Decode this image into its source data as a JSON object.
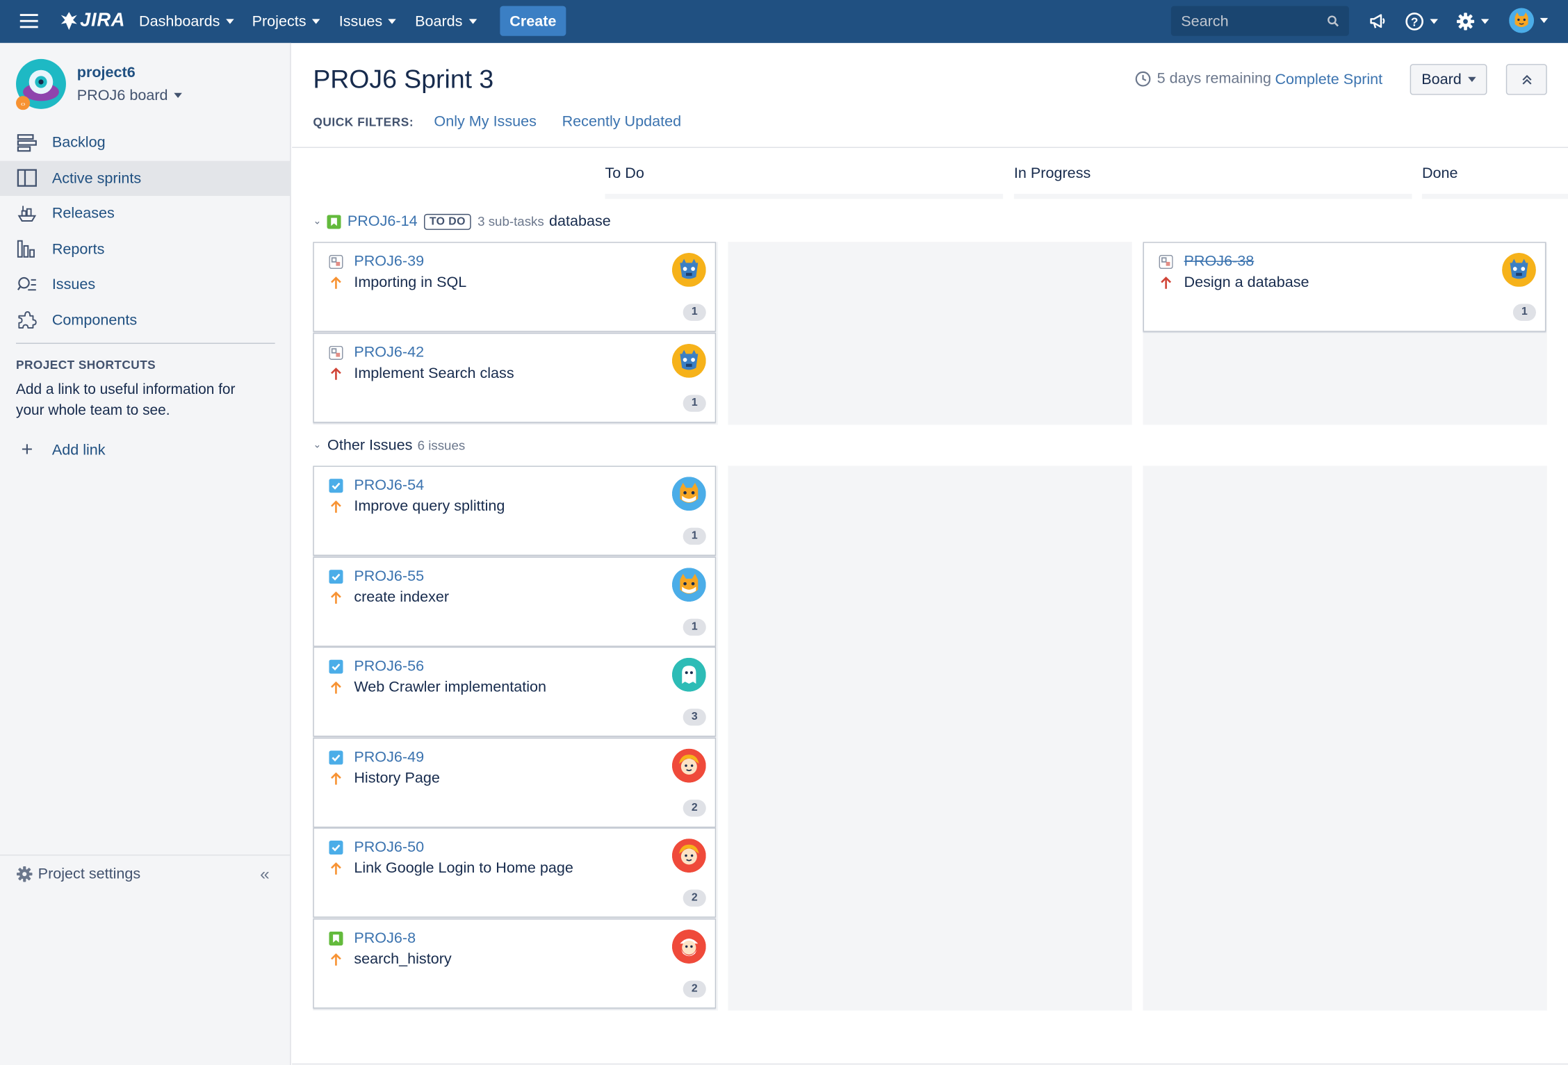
{
  "nav": {
    "logo": "JIRA",
    "dashboards": "Dashboards",
    "projects": "Projects",
    "issues": "Issues",
    "boards": "Boards",
    "create": "Create",
    "search_placeholder": "Search"
  },
  "sidebar": {
    "project_name": "project6",
    "board_name": "PROJ6 board",
    "items": [
      {
        "label": "Backlog",
        "icon": "backlog-icon"
      },
      {
        "label": "Active sprints",
        "icon": "active-sprints-icon",
        "active": true
      },
      {
        "label": "Releases",
        "icon": "releases-icon"
      },
      {
        "label": "Reports",
        "icon": "reports-icon"
      },
      {
        "label": "Issues",
        "icon": "issues-icon"
      },
      {
        "label": "Components",
        "icon": "components-icon"
      }
    ],
    "shortcuts_title": "PROJECT SHORTCUTS",
    "shortcuts_desc": "Add a link to useful information for your whole team to see.",
    "add_link": "Add link",
    "project_settings": "Project settings"
  },
  "main": {
    "title": "PROJ6 Sprint 3",
    "remaining": "5 days remaining",
    "complete_sprint": "Complete Sprint",
    "board_button": "Board",
    "quick_filters_label": "QUICK FILTERS:",
    "filters": [
      "Only My Issues",
      "Recently Updated"
    ],
    "columns": [
      "To Do",
      "In Progress",
      "Done"
    ]
  },
  "swimlanes": [
    {
      "key": "PROJ6-14",
      "status": "TO DO",
      "subtasks": "3 sub-tasks",
      "summary": "database"
    },
    {
      "label": "Other Issues",
      "count": "6 issues"
    }
  ],
  "cards": {
    "lane1_todo": [
      {
        "key": "PROJ6-39",
        "summary": "Importing in SQL",
        "estimate": "1",
        "type": "subtask",
        "priority": "high"
      },
      {
        "key": "PROJ6-42",
        "summary": "Implement Search class",
        "estimate": "1",
        "type": "subtask",
        "priority": "highest"
      }
    ],
    "lane1_done": [
      {
        "key": "PROJ6-38",
        "summary": "Design a database",
        "estimate": "1",
        "type": "subtask",
        "priority": "highest"
      }
    ],
    "lane2_todo": [
      {
        "key": "PROJ6-54",
        "summary": "Improve query splitting",
        "estimate": "1",
        "type": "task",
        "priority": "high"
      },
      {
        "key": "PROJ6-55",
        "summary": "create indexer",
        "estimate": "1",
        "type": "task",
        "priority": "high"
      },
      {
        "key": "PROJ6-56",
        "summary": "Web Crawler implementation",
        "estimate": "3",
        "type": "task",
        "priority": "high"
      },
      {
        "key": "PROJ6-49",
        "summary": "History Page",
        "estimate": "2",
        "type": "task",
        "priority": "high"
      },
      {
        "key": "PROJ6-50",
        "summary": "Link Google Login to Home page",
        "estimate": "2",
        "type": "task",
        "priority": "high"
      },
      {
        "key": "PROJ6-8",
        "summary": "search_history",
        "estimate": "2",
        "type": "story",
        "priority": "high"
      }
    ]
  },
  "colors": {
    "nav_bg": "#205081",
    "link": "#3b73af",
    "priority_high": "#f79232",
    "priority_highest": "#d04437",
    "task": "#4bade8",
    "story": "#63ba3c"
  }
}
